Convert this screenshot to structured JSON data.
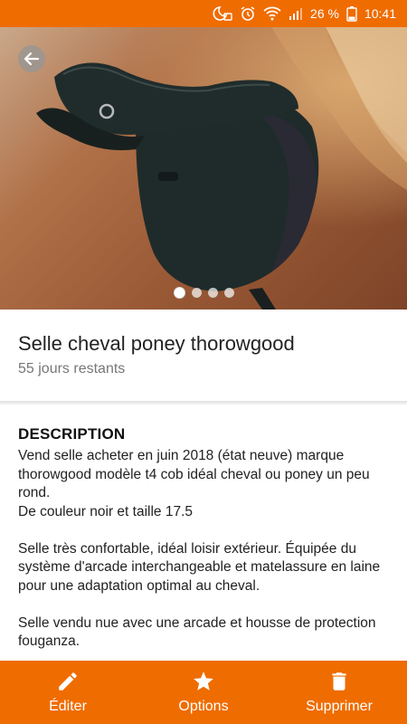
{
  "status_bar": {
    "battery": "26 %",
    "time": "10:41",
    "icons": [
      "do-not-disturb-icon",
      "alarm-icon",
      "wifi-icon",
      "signal-icon",
      "battery-icon"
    ]
  },
  "hero": {
    "image": "saddle-photo",
    "page_count": 4,
    "active_page": 1
  },
  "listing": {
    "title": "Selle cheval poney thorowgood",
    "remaining": "55 jours restants"
  },
  "description": {
    "heading": "DESCRIPTION",
    "body": "Vend selle acheter en juin 2018 (état neuve) marque thorowgood modèle t4 cob idéal cheval ou poney un peu rond.\nDe couleur noir et taille 17.5\n\nSelle très confortable, idéal loisir extérieur. Équipée du système d'arcade interchangeable et matelassure en laine pour une adaptation optimal au cheval.\n\nSelle vendu nue avec une arcade et housse de protection fouganza."
  },
  "bottom_bar": {
    "edit_label": "Éditer",
    "options_label": "Options",
    "delete_label": "Supprimer"
  },
  "colors": {
    "accent": "#ef6c00"
  }
}
